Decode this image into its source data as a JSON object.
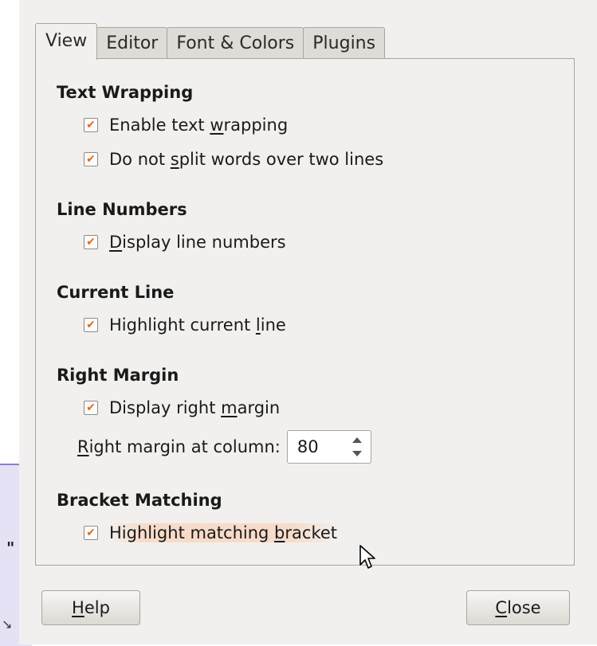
{
  "background": {
    "glyph": "\"",
    "resize_glyph": "↘"
  },
  "tabs": [
    {
      "label": "View",
      "active": true
    },
    {
      "label": "Editor",
      "active": false
    },
    {
      "label": "Font & Colors",
      "active": false
    },
    {
      "label": "Plugins",
      "active": false
    }
  ],
  "sections": {
    "text_wrapping": {
      "title": "Text Wrapping",
      "enable_wrapping": {
        "pre": "Enable text ",
        "mnemonic": "w",
        "post": "rapping",
        "checked": true
      },
      "no_split": {
        "pre": "Do not ",
        "mnemonic": "s",
        "post": "plit words over two lines",
        "checked": true
      }
    },
    "line_numbers": {
      "title": "Line Numbers",
      "display": {
        "pre": "",
        "mnemonic": "D",
        "post": "isplay line numbers",
        "checked": true
      }
    },
    "current_line": {
      "title": "Current Line",
      "highlight": {
        "pre": "Highlight current ",
        "mnemonic": "l",
        "post": "ine",
        "checked": true
      }
    },
    "right_margin": {
      "title": "Right Margin",
      "display": {
        "pre": "Display right ",
        "mnemonic": "m",
        "post": "argin",
        "checked": true
      },
      "column_label": {
        "pre": "",
        "mnemonic": "R",
        "post": "ight margin at column:"
      },
      "column_value": "80"
    },
    "bracket_matching": {
      "title": "Bracket Matching",
      "highlight": {
        "pre": "Highlight matching ",
        "mnemonic": "b",
        "post": "racket",
        "checked": true
      }
    }
  },
  "buttons": {
    "help": {
      "mnemonic": "H",
      "post": "elp"
    },
    "close": {
      "mnemonic": "C",
      "post": "lose"
    }
  },
  "check_glyph": "✔",
  "accent_color": "#e56a16"
}
